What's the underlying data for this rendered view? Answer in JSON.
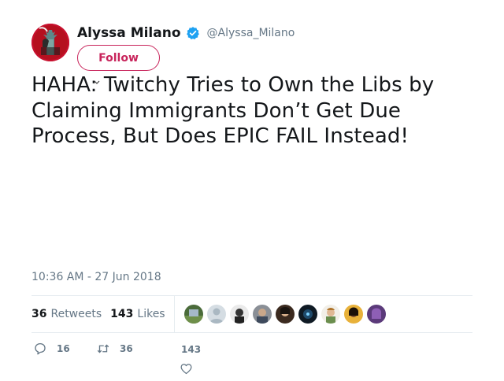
{
  "author": {
    "display_name": "Alyssa Milano",
    "handle": "@Alyssa_Milano",
    "avatar_icon": "statue-of-liberty-avatar",
    "verified_icon": "verified-badge-icon"
  },
  "follow_button": {
    "label": "Follow"
  },
  "tweet": {
    "text": "HAHA: Twitchy Tries to Own the Libs by Claiming Immigrants Don’t Get Due Process, But Does EPIC FAIL Instead!",
    "timestamp": "10:36 AM - 27 Jun 2018"
  },
  "stats": {
    "retweets_count": "36",
    "retweets_label": "Retweets",
    "likes_count": "143",
    "likes_label": "Likes"
  },
  "liker_faces": [
    "liker-avatar-1",
    "liker-avatar-2",
    "liker-avatar-3",
    "liker-avatar-4",
    "liker-avatar-5",
    "liker-avatar-6",
    "liker-avatar-7",
    "liker-avatar-8",
    "liker-avatar-9"
  ],
  "actions": {
    "reply_count": "16",
    "retweet_count": "36",
    "like_count": "143"
  },
  "colors": {
    "text_primary": "#14171a",
    "text_secondary": "#657786",
    "follow_accent": "#c8245b",
    "verified_blue": "#1da1f2",
    "divider": "#e6ecf0"
  }
}
